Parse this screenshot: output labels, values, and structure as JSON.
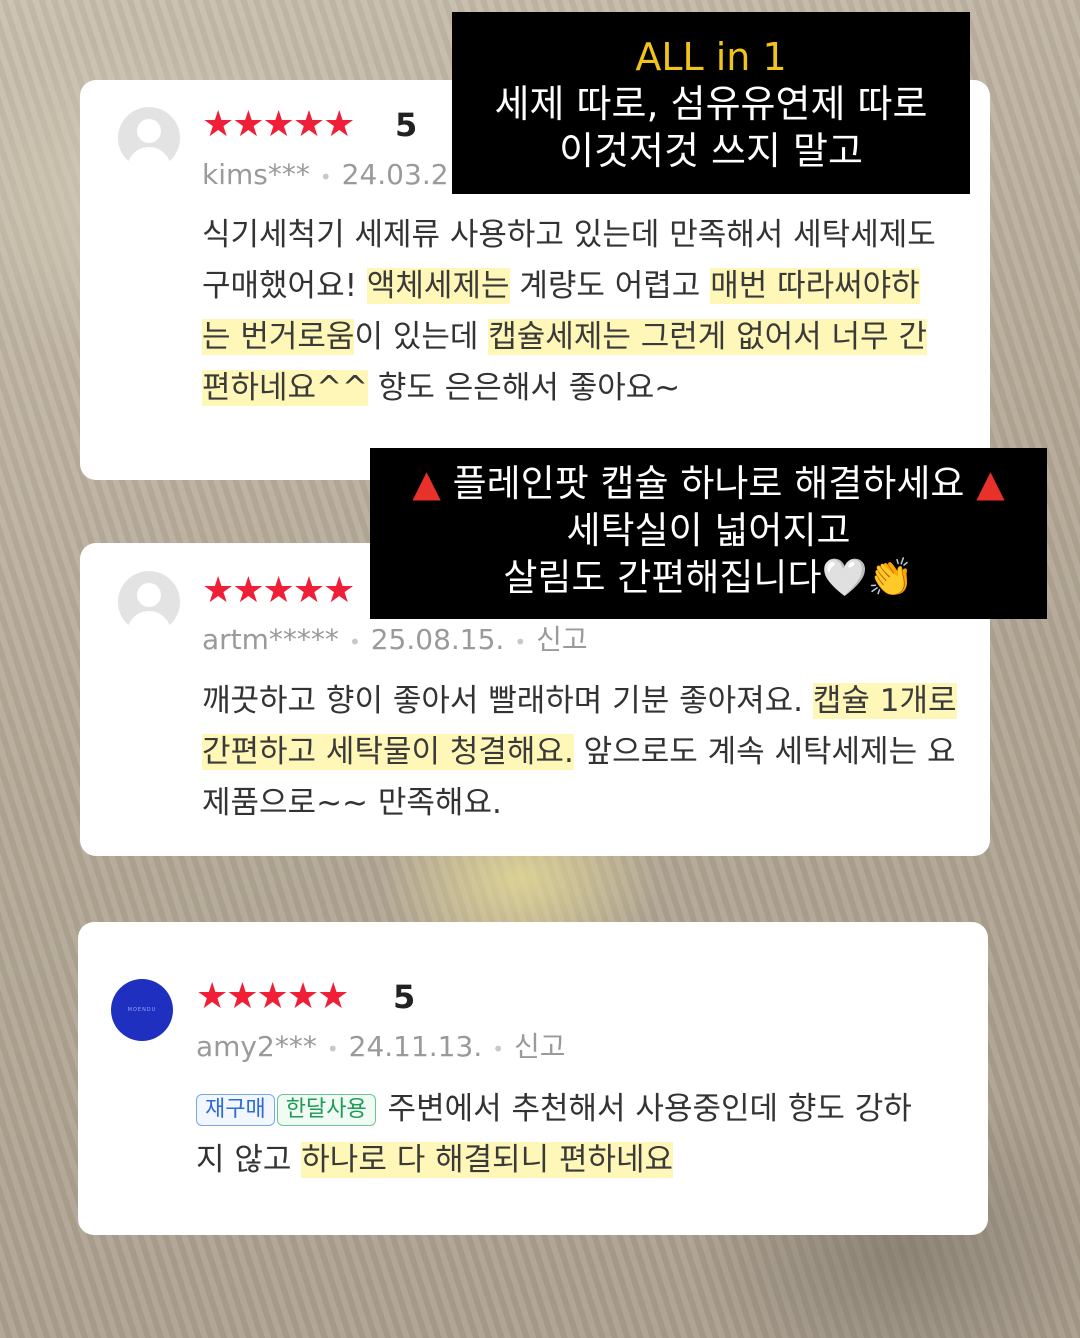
{
  "banner_top": {
    "title": "ALL in 1",
    "line1": "세제 따로, 섬유유연제 따로",
    "line2": "이것저것 쓰지 말고"
  },
  "banner_mid": {
    "line1_icon_left": "▲",
    "line1": "플레인팟 캡슐 하나로 해결하세요",
    "line1_icon_right": "▲",
    "line2": "세탁실이 넓어지고",
    "line3": "살림도 간편해집니다",
    "emoji_heart": "🤍",
    "emoji_clap": "👏"
  },
  "reviews": [
    {
      "stars": "★★★★★",
      "score": "5",
      "user": "kims***",
      "date": "24.03.2",
      "text": [
        {
          "t": "식기세척기 세제류 사용하고 있는데 만족해서 세탁세제도 구매했어요! "
        },
        {
          "t": "액체세제는",
          "hl": true
        },
        {
          "t": " 계량도 어렵고 "
        },
        {
          "t": "매번 따라써야하는 번거로움",
          "hl": true
        },
        {
          "t": "이 있는데 "
        },
        {
          "t": "캡슐세제는 그런게 없어서 너무 간편하네요^^",
          "hl": true
        },
        {
          "t": " 향도 은은해서 좋아요~"
        }
      ]
    },
    {
      "stars": "★★★★★",
      "user": "artm*****",
      "date": "25.08.15.",
      "report": "신고",
      "text": [
        {
          "t": "깨끗하고 향이 좋아서 빨래하며 기분 좋아져요. "
        },
        {
          "t": "캡슐 1개로 간편하고 세탁물이 청결해요.",
          "hl": true
        },
        {
          "t": " 앞으로도 계속 세탁세제는 요제품으로~~ 만족해요."
        }
      ]
    },
    {
      "stars": "★★★★★",
      "score": "5",
      "user": "amy2***",
      "date": "24.11.13.",
      "report": "신고",
      "avatar_text": "MOENDU",
      "tags": [
        "재구매",
        "한달사용"
      ],
      "text": [
        {
          "t": " 주변에서 추천해서 사용중인데 향도 강하지 않고 "
        },
        {
          "t": "하나로 다 해결되니 편하네요 ",
          "hl": true
        }
      ]
    }
  ],
  "colors": {
    "star": "#f01e36",
    "highlight": "#fff7b8",
    "banner_bg": "#000000",
    "banner_accent": "#f0c419",
    "tag_blue": "#2e6bd8",
    "tag_green": "#1d9a55"
  }
}
